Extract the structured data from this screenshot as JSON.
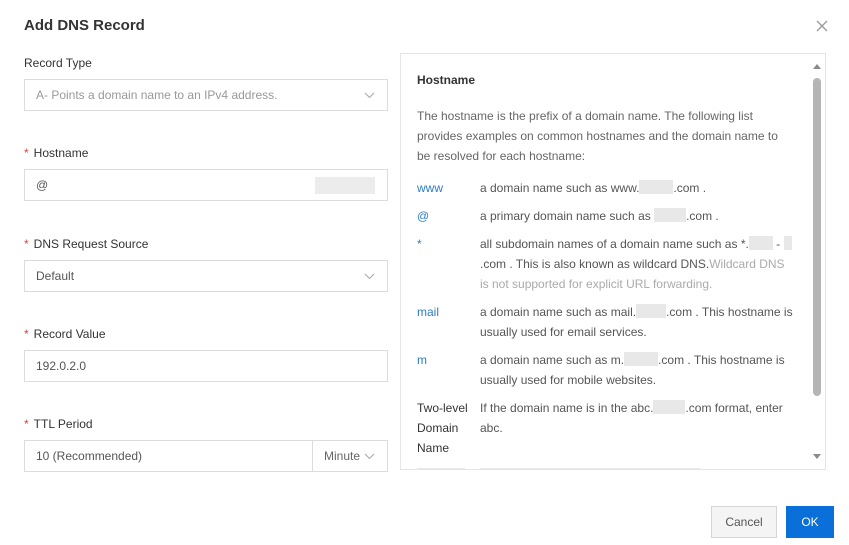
{
  "dialog": {
    "title": "Add DNS Record",
    "close_icon": "close-icon"
  },
  "form": {
    "record_type": {
      "label": "Record Type",
      "value": "A- Points a domain name to an IPv4 address."
    },
    "hostname": {
      "required_mark": "*",
      "label": "Hostname",
      "value": "@"
    },
    "dns_request_source": {
      "required_mark": "*",
      "label": "DNS Request Source",
      "value": "Default"
    },
    "record_value": {
      "required_mark": "*",
      "label": "Record Value",
      "value": "192.0.2.0"
    },
    "ttl_period": {
      "required_mark": "*",
      "label": "TTL Period",
      "value": "10 (Recommended)",
      "unit": "Minute"
    }
  },
  "help": {
    "title": "Hostname",
    "intro": "The hostname is the prefix of a domain name. The following list provides examples on common hostnames and the domain name to be resolved for each hostname:",
    "rows": [
      {
        "key": "www",
        "pre": "a domain name such as www.",
        "post": ".com ."
      },
      {
        "key": "@",
        "pre": "a primary domain name such as ",
        "post": ".com ."
      },
      {
        "key": "*",
        "pre": "all subdomain names of a domain name such as *.",
        "mid": " -",
        "post": ".com . This is also known as wildcard DNS.",
        "muted": "Wildcard DNS is not supported for explicit URL forwarding."
      },
      {
        "key": "mail",
        "pre": "a domain name such as mail.",
        "post": ".com . This hostname is usually used for email services."
      },
      {
        "key": "m",
        "pre": "a domain name such as m.",
        "post": ".com . This hostname is usually used for mobile websites."
      },
      {
        "key": "Two-level Domain Name",
        "pre": "If the domain name is in the abc.",
        "post": ".com format, enter abc."
      }
    ]
  },
  "footer": {
    "cancel_label": "Cancel",
    "ok_label": "OK"
  },
  "colors": {
    "accent": "#0a6fd8",
    "required": "#e0403c",
    "link": "#2e7dc6"
  }
}
